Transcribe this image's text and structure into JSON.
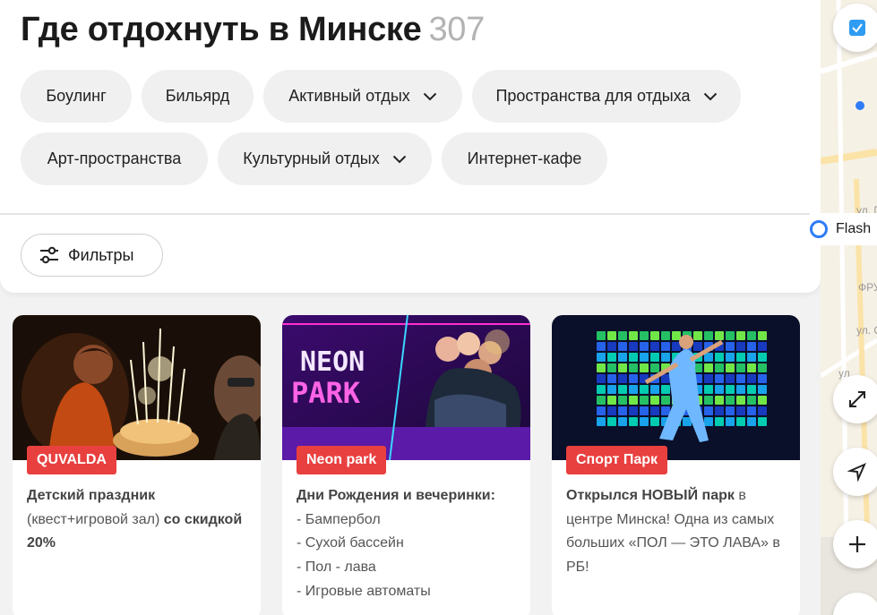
{
  "header": {
    "title": "Где отдохнуть в Минске",
    "count": "307"
  },
  "chips": [
    {
      "label": "Боулинг",
      "dropdown": false
    },
    {
      "label": "Бильярд",
      "dropdown": false
    },
    {
      "label": "Активный отдых",
      "dropdown": true
    },
    {
      "label": "Пространства для отдыха",
      "dropdown": true
    },
    {
      "label": "Арт-пространства",
      "dropdown": false
    },
    {
      "label": "Культурный отдых",
      "dropdown": true
    },
    {
      "label": "Интернет-кафе",
      "dropdown": false
    }
  ],
  "filters": {
    "label": "Фильтры"
  },
  "cards": [
    {
      "badge": "QUVALDA",
      "text_bold": "Детский праздник",
      "text_normal": " (квест+игровой зал) ",
      "text_bold2": "со скидкой 20%"
    },
    {
      "badge": "Neon park",
      "text_bold": "Дни Рождения и вечеринки:",
      "list": [
        "- Бампербол",
        "- Сухой бассейн",
        "- Пол - лава",
        "- Игровые автоматы"
      ],
      "image_logo_top": "NEON",
      "image_logo_bottom": "PARK"
    },
    {
      "badge": "Спорт Парк",
      "text_bold": "Открылся НОВЫЙ парк",
      "text_normal": " в центре Минска! Одна из самых больших «ПОЛ — ЭТО ЛАВА» в РБ!"
    }
  ],
  "map": {
    "place_label": "Flash",
    "street_labels": [
      "ФРУ",
      "ул. Од",
      "ул",
      "ул. П"
    ],
    "accent": "#2e7df6"
  },
  "colors": {
    "badge": "#e8403f",
    "count": "#b3b3b3",
    "chip_bg": "#f0f0f0"
  }
}
